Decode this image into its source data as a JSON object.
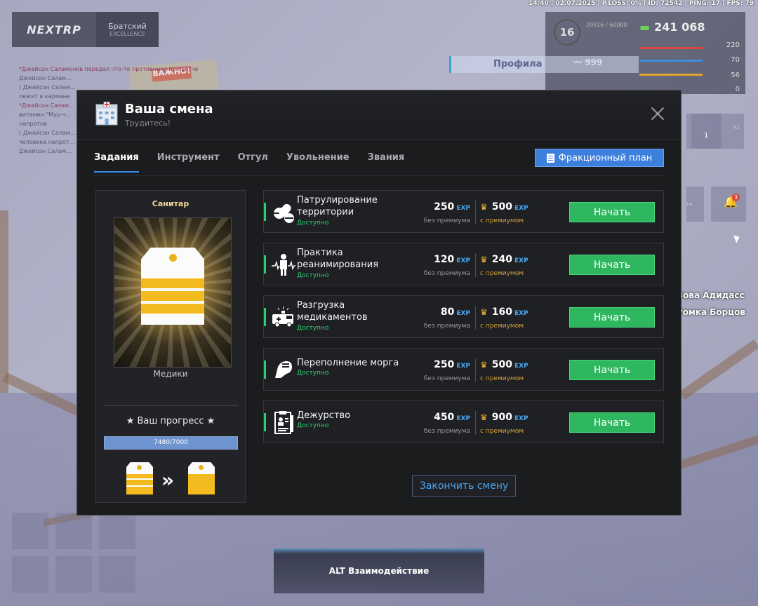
{
  "hud": {
    "top_status": "14:40 | 02.07.2025 | P.LOSS: 0% | ID: 72542 | PING: 17 | FPS: 79",
    "server_logo": "NEXTRP",
    "server_name": "Братский",
    "server_sub": "EXCELLENCE",
    "level": "16",
    "level_exp": "20916 / 60000",
    "money": "241 068",
    "donate": "999",
    "stat_health": "220",
    "stat_food": "70",
    "stat_water": "56",
    "stat_armor": "0",
    "profile_label": "Профила",
    "slot_count": "1",
    "key_f2": "F2",
    "key_f9": "F9",
    "notification_count": "3",
    "alt_hint": "ALT Взаимодействие",
    "chat": [
      "*Джейсон Саламонов передал что-то противнику по протче",
      "Джейсон Салам...",
      "( Джейсон Салам...",
      "лежит в кармане",
      "*Джейсон Салам...",
      "витамин \"Мур-ч...",
      "напротив",
      "( Джейсон Салам...",
      "человека напрот...",
      "Джейсон Салам..."
    ],
    "nearby_players": [
      "Вова Адидасс",
      "Ромка Борцов"
    ]
  },
  "modal": {
    "title": "Ваша смена",
    "subtitle": "Трудитесь!",
    "tabs": [
      "Задания",
      "Инструмент",
      "Отгул",
      "Увольнение",
      "Звания"
    ],
    "active_tab": 0,
    "plan_button": "Фракционный план",
    "finish_button": "Закончить смену"
  },
  "rank": {
    "name": "Санитар",
    "group": "Медики",
    "progress_title": "★ Ваш прогресс ★",
    "progress_text": "7480/7000",
    "progress_fraction": 1.0
  },
  "labels": {
    "exp": "EXP",
    "no_premium": "без премиума",
    "with_premium": "с премиумом",
    "start": "Начать"
  },
  "tasks": [
    {
      "name_line1": "Патрулирование",
      "name_line2": "территории",
      "status": "Доступно",
      "exp": "250",
      "exp_premium": "500",
      "icon": "pills-icon"
    },
    {
      "name_line1": "Практика",
      "name_line2": "реанимирования",
      "status": "Доступно",
      "exp": "120",
      "exp_premium": "240",
      "icon": "reanimation-icon"
    },
    {
      "name_line1": "Разгрузка",
      "name_line2": "медикаментов",
      "status": "Доступно",
      "exp": "80",
      "exp_premium": "160",
      "icon": "ambulance-icon"
    },
    {
      "name_line1": "Переполнение морга",
      "name_line2": "",
      "status": "Доступно",
      "exp": "250",
      "exp_premium": "500",
      "icon": "morgue-icon"
    },
    {
      "name_line1": "Дежурство",
      "name_line2": "",
      "status": "Доступно",
      "exp": "450",
      "exp_premium": "900",
      "icon": "clipboard-icon"
    }
  ],
  "colors": {
    "accent_blue": "#3d7fdc",
    "start_green": "#2fb75f",
    "exp_blue": "#4aa6f0",
    "premium_gold": "#d6a13a",
    "status_green": "#2ecc71"
  }
}
